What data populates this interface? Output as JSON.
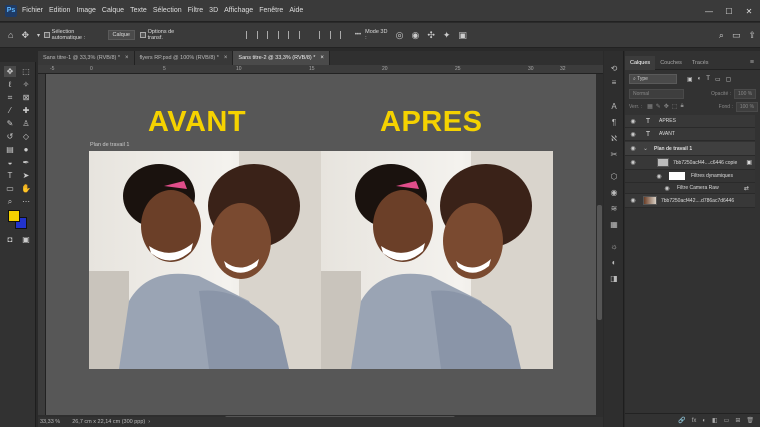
{
  "app": {
    "logo": "Ps"
  },
  "menu": [
    "Fichier",
    "Edition",
    "Image",
    "Calque",
    "Texte",
    "Sélection",
    "Filtre",
    "3D",
    "Affichage",
    "Fenêtre",
    "Aide"
  ],
  "window_controls": {
    "minimize": "—",
    "maximize": "☐",
    "close": "✕"
  },
  "options": {
    "auto_select_label": "Sélection automatique :",
    "auto_select_value": "Calque",
    "transform_label": "Options de transf.",
    "mode3d_label": "Mode 3D :",
    "more": "•••"
  },
  "tabs": [
    {
      "label": "Sans titre-1 @ 33,3% (RVB/8) *",
      "close": "×"
    },
    {
      "label": "flyers RP.psd @ 100% (RVB/8) *",
      "close": "×"
    },
    {
      "label": "Sans titre-2 @ 33,3% (RVB/8) *",
      "close": "×"
    }
  ],
  "ruler_ticks": [
    "-5",
    "0",
    "5",
    "10",
    "15",
    "20",
    "25",
    "30",
    "32"
  ],
  "canvas": {
    "title_left": "AVANT",
    "title_right": "APRES",
    "artboard_label": "Plan de travail 1"
  },
  "status": {
    "zoom": "33,33 %",
    "doc_size": "26,7 cm x 22,14 cm (300 ppp)"
  },
  "panel": {
    "tabs": [
      "Calques",
      "Couches",
      "Tracés"
    ],
    "filter_type": "Type",
    "blend_mode": "Normal",
    "opacity_label": "Opacité :",
    "opacity_value": "100 %",
    "lock_label": "Verr. :",
    "fill_label": "Fond :",
    "fill_value": "100 %",
    "layers": [
      {
        "name": "APRES",
        "kind": "T"
      },
      {
        "name": "AVANT",
        "kind": "T"
      },
      {
        "name": "Plan de travail 1",
        "kind": "group"
      },
      {
        "name": "7bb7250acf44....c6446 copie",
        "kind": "smart"
      },
      {
        "name": "Filtres dynamiques",
        "kind": "filters"
      },
      {
        "name": "Filtre Camera Raw",
        "kind": "filter"
      },
      {
        "name": "7bb7250acf442....d786ac7d6446",
        "kind": "image"
      }
    ],
    "bottom_icons": [
      "🔗",
      "fx",
      "◐",
      "◧",
      "▭",
      "⊞",
      "🗑"
    ]
  },
  "colors": {
    "accent_yellow": "#f5d200",
    "foreground": "#f5d200",
    "background": "#2233cc"
  }
}
